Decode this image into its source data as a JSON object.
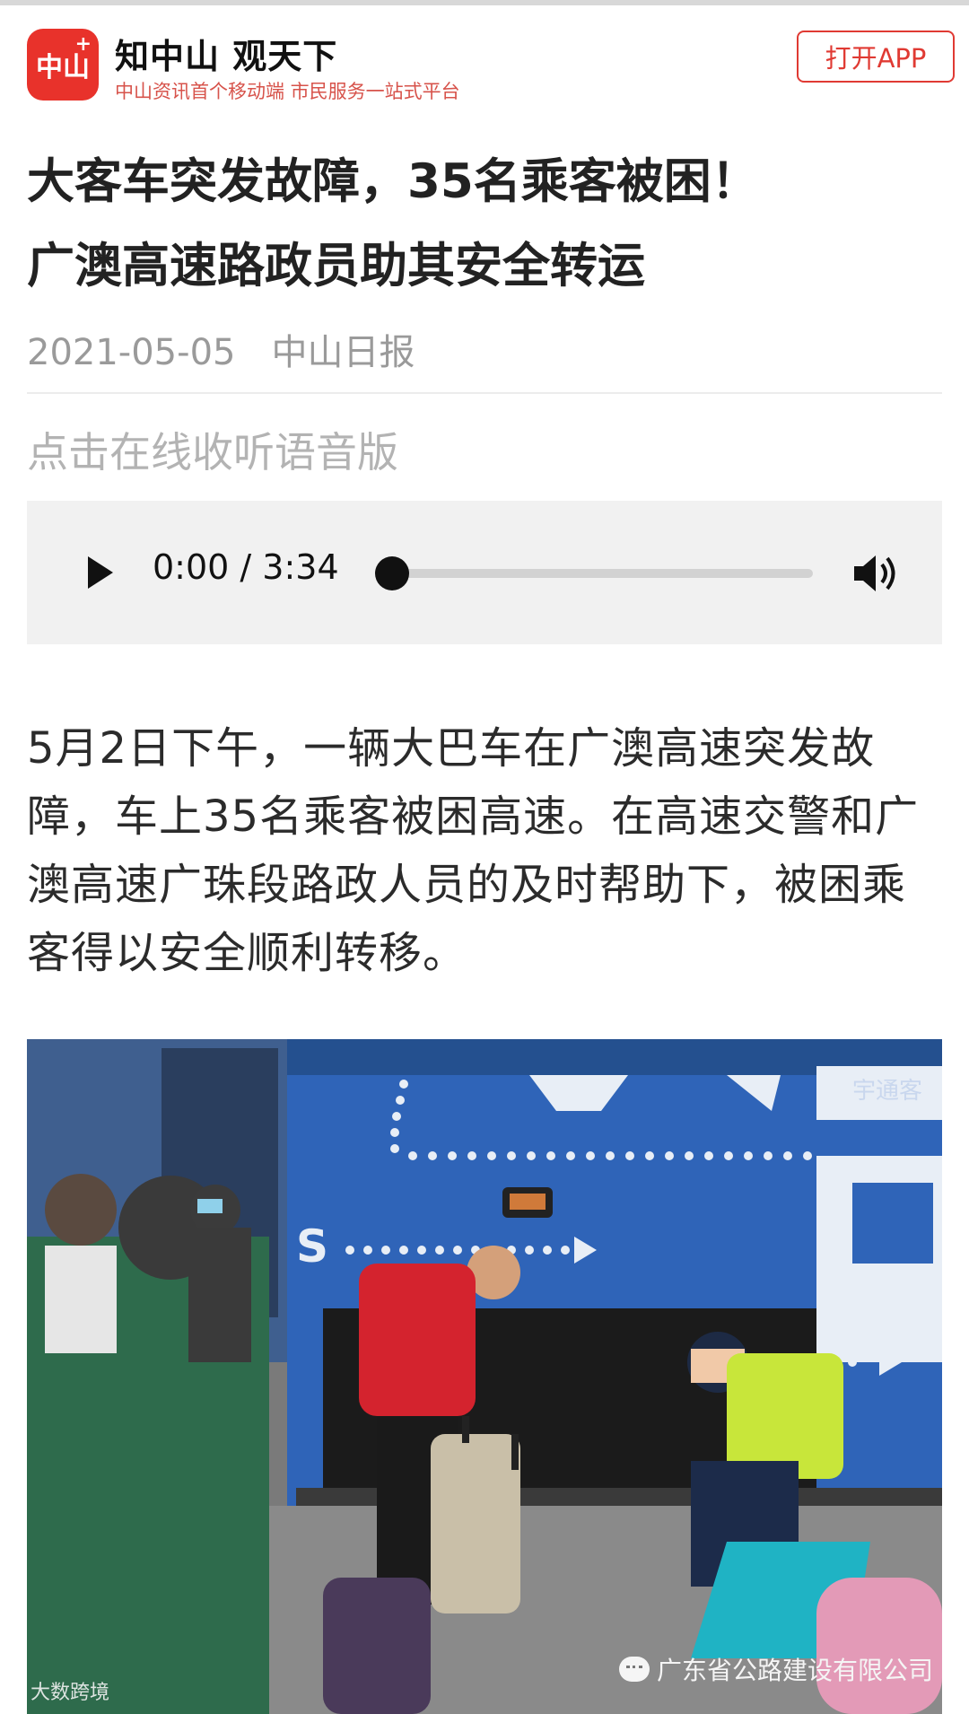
{
  "header": {
    "logo_text": "中山",
    "logo_plus": "+",
    "brand_title": "知中山  观天下",
    "brand_subtitle": "中山资讯首个移动端  市民服务一站式平台",
    "open_app_label": "打开APP"
  },
  "article": {
    "title_line1": "大客车突发故障，35名乘客被困！",
    "title_line2": "广澳高速路政员助其安全转运",
    "date": "2021-05-05",
    "source": "中山日报",
    "listen_label": "点击在线收听语音版",
    "body": "5月2日下午，一辆大巴车在广澳高速突发故障，车上35名乘客被困高速。在高速交警和广澳高速广珠段路政人员的及时帮助下，被困乘客得以安全顺利转移。"
  },
  "audio": {
    "time_display": "0:00 / 3:34",
    "progress": 0,
    "icons": [
      "play-icon",
      "volume-icon"
    ]
  },
  "photo": {
    "bus_text": "宇通客",
    "watermark_left": "大数跨境",
    "watermark_right": "广东省公路建设有限公司"
  },
  "colors": {
    "brand_red": "#e8322b",
    "sub_red": "#d7534b",
    "bus_blue": "#2f64b8"
  }
}
